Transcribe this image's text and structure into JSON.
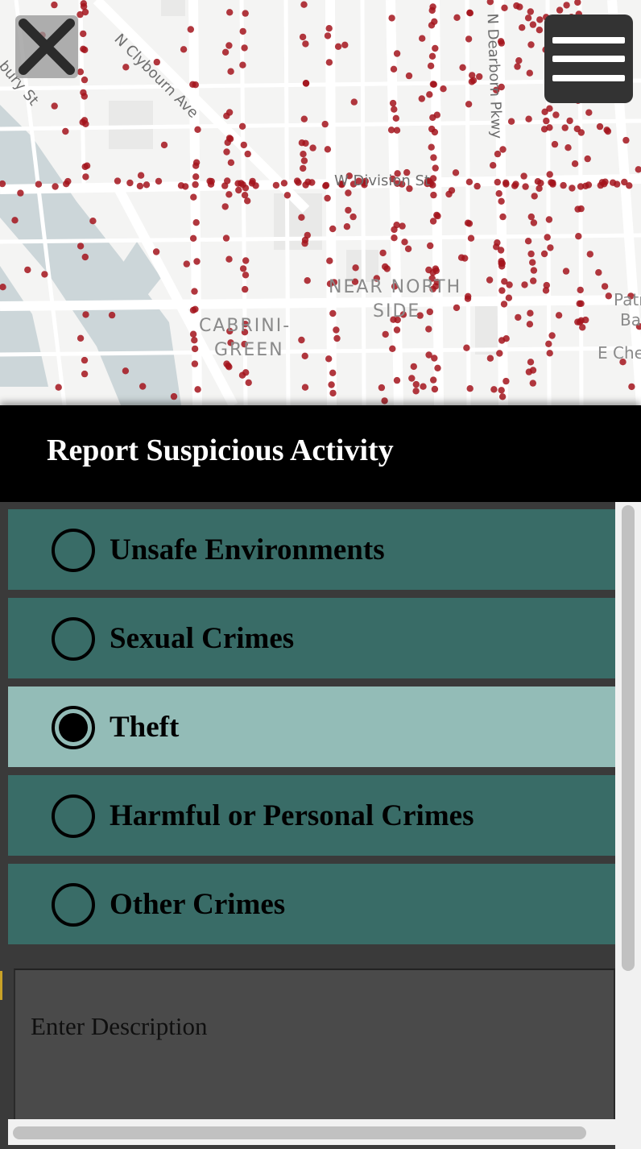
{
  "map": {
    "neighborhoods": [
      "NEAR NORTH",
      "SIDE",
      "CABRINI-",
      "GREEN",
      "Patr",
      "Ba",
      "E Che"
    ],
    "streets": [
      "N Clybourn Ave",
      "W Division St",
      "N Dearborn Pkwy",
      "bury St"
    ],
    "incident_color": "#a3141c"
  },
  "controls": {
    "close_icon": "close-icon",
    "menu_icon": "hamburger-menu-icon"
  },
  "report": {
    "title": "Report Suspicious Activity",
    "options": [
      {
        "label": "Unsafe Environments",
        "selected": false
      },
      {
        "label": "Sexual Crimes",
        "selected": false
      },
      {
        "label": "Theft",
        "selected": true
      },
      {
        "label": "Harmful or Personal Crimes",
        "selected": false
      },
      {
        "label": "Other Crimes",
        "selected": false
      }
    ],
    "description_placeholder": "Enter Description"
  },
  "colors": {
    "option_bg": "#396c67",
    "option_selected_bg": "#93bcb7",
    "header_bg": "#000000"
  }
}
